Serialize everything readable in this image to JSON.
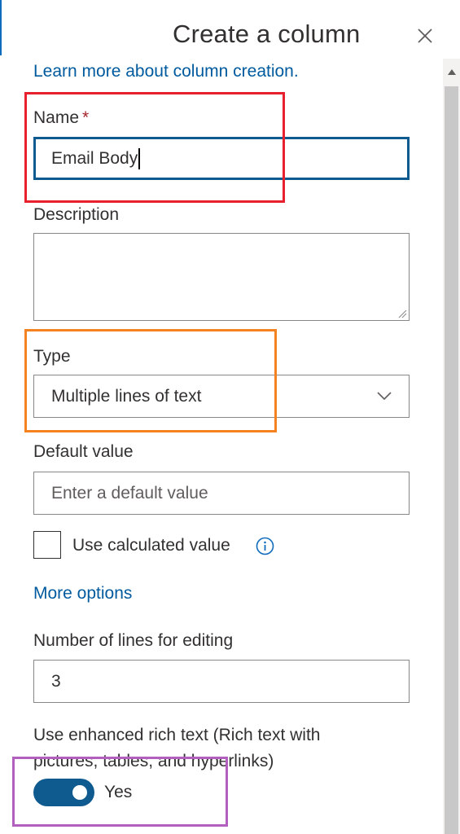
{
  "panel": {
    "title": "Create a column",
    "learn_more_link": "Learn more about column creation."
  },
  "name_field": {
    "label": "Name",
    "required_marker": "*",
    "value": "Email Body"
  },
  "description_field": {
    "label": "Description",
    "value": ""
  },
  "type_field": {
    "label": "Type",
    "selected": "Multiple lines of text"
  },
  "default_value_field": {
    "label": "Default value",
    "placeholder": "Enter a default value"
  },
  "calculated_value": {
    "label": "Use calculated value",
    "checked": false
  },
  "more_options_link": "More options",
  "lines_field": {
    "label": "Number of lines for editing",
    "value": "3"
  },
  "rich_text": {
    "label_line1": "Use enhanced rich text (Rich text with",
    "label_line2": "pictures, tables, and hyperlinks)",
    "toggle_label": "Yes",
    "enabled": true
  },
  "colors": {
    "accent": "#0f5a8f",
    "link": "#005a9e",
    "highlight_name": "#e8202e",
    "highlight_type": "#f58220",
    "highlight_toggle": "#b25fbf"
  }
}
